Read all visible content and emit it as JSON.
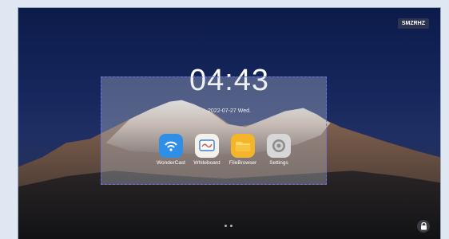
{
  "screen": {
    "clock": "04:43",
    "date": "2022-07-27  Wed.",
    "device_tag": "SMZRHZ"
  },
  "apps": [
    {
      "label": "WonderCast",
      "icon": "cast-icon",
      "color": "#2f8fe6"
    },
    {
      "label": "Whiteboard",
      "icon": "whiteboard-icon",
      "color": "#f3f1ea"
    },
    {
      "label": "FileBrowser",
      "icon": "folder-icon",
      "color": "#f4b52a"
    },
    {
      "label": "Settings",
      "icon": "gear-icon",
      "color": "#d7d7d7"
    }
  ],
  "selection_color": "#6a6ef2",
  "page_indicator": {
    "pages": 2,
    "current": 1
  }
}
